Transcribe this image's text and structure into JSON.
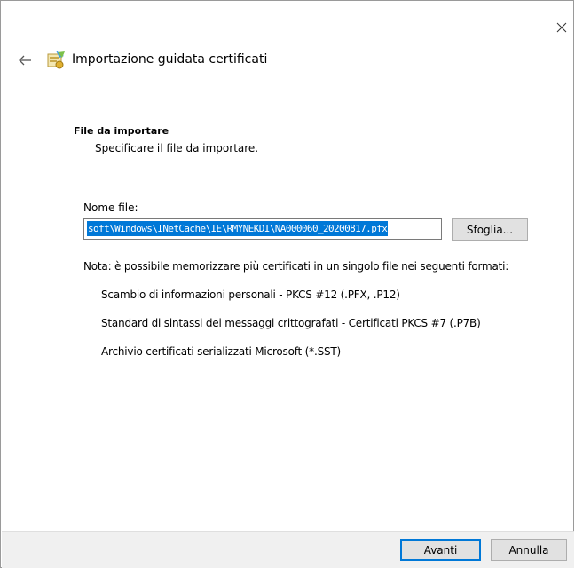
{
  "window": {
    "title": "Importazione guidata certificati"
  },
  "section": {
    "heading": "File da importare",
    "description": "Specificare il file da importare."
  },
  "file": {
    "label": "Nome file:",
    "value": "soft\\Windows\\INetCache\\IE\\RMYNEKDI\\NA000060_20200817.pfx",
    "browse_label": "Sfoglia..."
  },
  "note": "Nota: è possibile memorizzare più certificati in un singolo file nei seguenti formati:",
  "formats": [
    "Scambio di informazioni personali - PKCS #12 (.PFX, .P12)",
    "Standard di sintassi dei messaggi crittografati - Certificati PKCS #7 (.P7B)",
    "Archivio certificati serializzati Microsoft (*.SST)"
  ],
  "footer": {
    "next_label": "Avanti",
    "cancel_label": "Annulla"
  },
  "icons": {
    "close": "close-icon",
    "back": "back-arrow-icon",
    "wizard": "certificate-wizard-icon"
  },
  "colors": {
    "selection": "#0078d7",
    "footer_bg": "#f0f0f0",
    "button_bg": "#e1e1e1"
  }
}
